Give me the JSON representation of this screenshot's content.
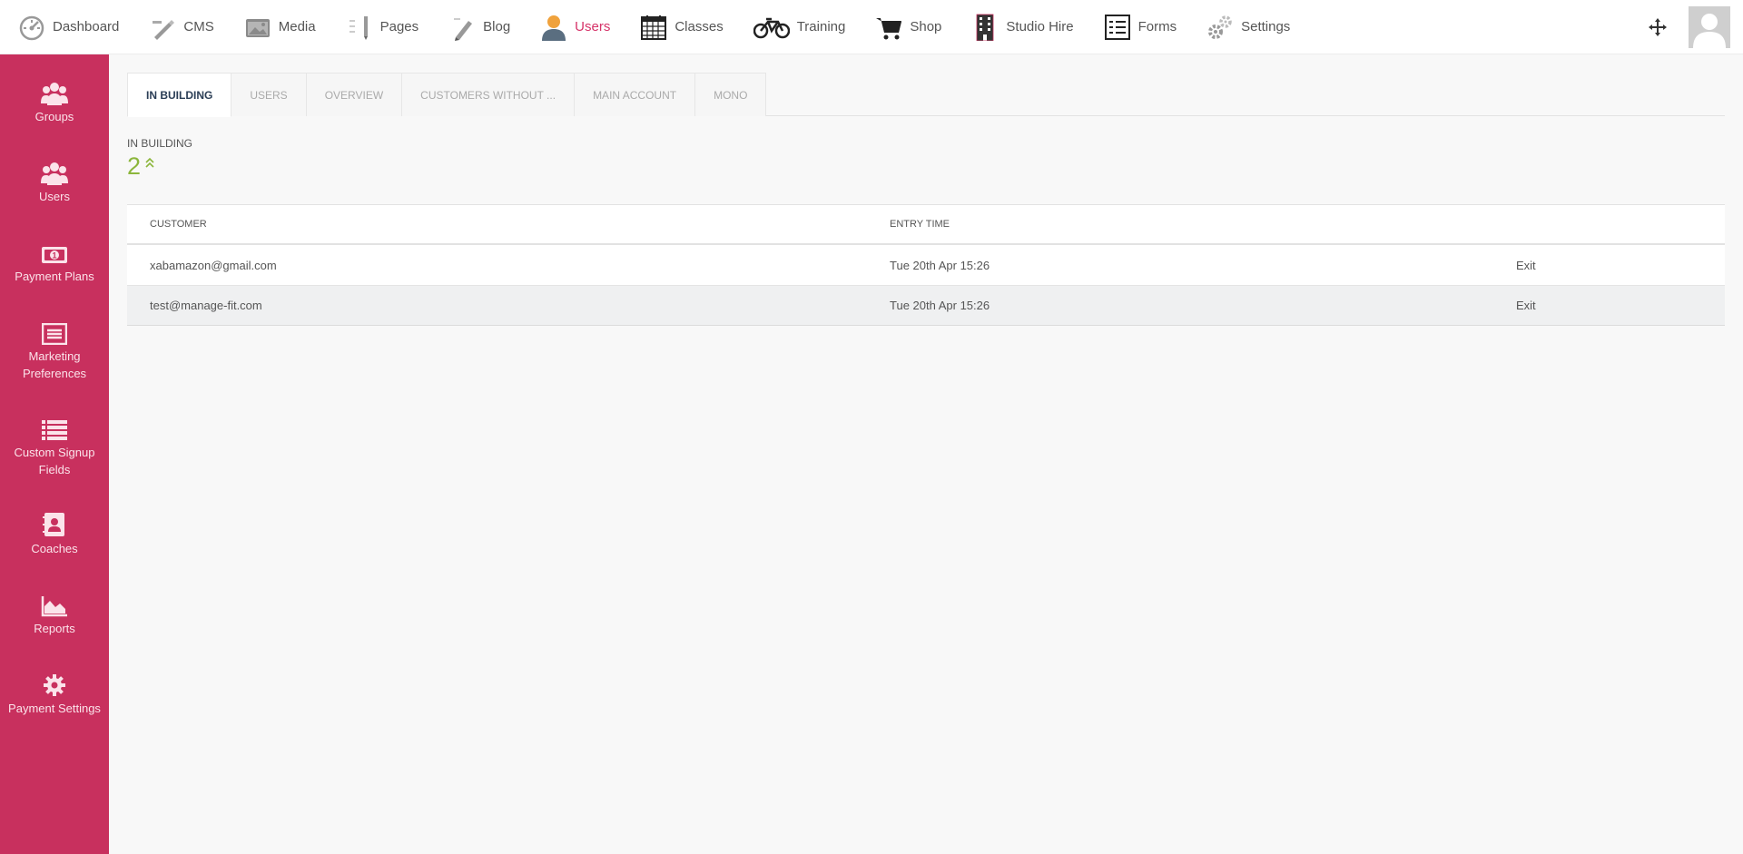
{
  "topnav": {
    "items": [
      {
        "label": "Dashboard",
        "icon": "speedometer-icon"
      },
      {
        "label": "CMS",
        "icon": "cms-tools-icon"
      },
      {
        "label": "Media",
        "icon": "camera-icon"
      },
      {
        "label": "Pages",
        "icon": "pages-pen-icon"
      },
      {
        "label": "Blog",
        "icon": "pencil-icon"
      },
      {
        "label": "Users",
        "icon": "user-icon",
        "active": true
      },
      {
        "label": "Classes",
        "icon": "calendar-icon"
      },
      {
        "label": "Training",
        "icon": "bicycle-icon"
      },
      {
        "label": "Shop",
        "icon": "cart-icon"
      },
      {
        "label": "Studio Hire",
        "icon": "building-icon"
      },
      {
        "label": "Forms",
        "icon": "form-icon"
      },
      {
        "label": "Settings",
        "icon": "gears-icon"
      }
    ],
    "accent": "#d63369"
  },
  "sidebar": {
    "background": "#c8305e",
    "items": [
      {
        "label": "Groups",
        "icon": "group-icon"
      },
      {
        "label": "Users",
        "icon": "users-icon"
      },
      {
        "label": "Payment Plans",
        "icon": "money-icon"
      },
      {
        "label": "Marketing Preferences",
        "icon": "list-box-icon"
      },
      {
        "label": "Custom Signup Fields",
        "icon": "list-icon"
      },
      {
        "label": "Coaches",
        "icon": "address-book-icon"
      },
      {
        "label": "Reports",
        "icon": "area-chart-icon"
      },
      {
        "label": "Payment Settings",
        "icon": "gear-icon"
      }
    ]
  },
  "tabs": [
    {
      "label": "IN BUILDING",
      "active": true
    },
    {
      "label": "USERS"
    },
    {
      "label": "OVERVIEW"
    },
    {
      "label": "CUSTOMERS WITHOUT ..."
    },
    {
      "label": "MAIN ACCOUNT"
    },
    {
      "label": "MONO"
    }
  ],
  "stat": {
    "label": "IN BUILDING",
    "value": "2",
    "color": "#8cb63c"
  },
  "table": {
    "headers": [
      "CUSTOMER",
      "ENTRY TIME"
    ],
    "rows": [
      {
        "customer": "xabamazon@gmail.com",
        "entry_time": "Tue 20th Apr 15:26",
        "action": "Exit"
      },
      {
        "customer": "test@manage-fit.com",
        "entry_time": "Tue 20th Apr 15:26",
        "action": "Exit"
      }
    ]
  }
}
